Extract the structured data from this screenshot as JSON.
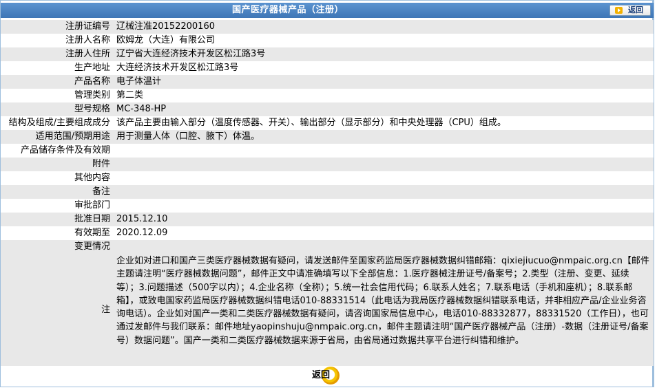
{
  "header": {
    "title": "国产医疗器械产品（注册）",
    "back_label": "返回"
  },
  "fields": [
    {
      "label": "注册证编号",
      "value": "辽械注准20152200160"
    },
    {
      "label": "注册人名称",
      "value": "欧姆龙（大连）有限公司"
    },
    {
      "label": "注册人住所",
      "value": "辽宁省大连经济技术开发区松江路3号"
    },
    {
      "label": "生产地址",
      "value": "大连经济技术开发区松江路3号"
    },
    {
      "label": "产品名称",
      "value": "电子体温计"
    },
    {
      "label": "管理类别",
      "value": "第二类"
    },
    {
      "label": "型号规格",
      "value": "MC-348-HP"
    },
    {
      "label": "结构及组成/主要组成成分",
      "value": "该产品主要由输入部分（温度传感器、开关）、输出部分（显示部分）和中央处理器（CPU）组成。"
    },
    {
      "label": "适用范围/预期用途",
      "value": "用于测量人体（口腔、腋下）体温。"
    },
    {
      "label": "产品储存条件及有效期",
      "value": ""
    },
    {
      "label": "附件",
      "value": ""
    },
    {
      "label": "其他内容",
      "value": ""
    },
    {
      "label": "备注",
      "value": ""
    },
    {
      "label": "审批部门",
      "value": ""
    },
    {
      "label": "批准日期",
      "value": "2015.12.10"
    },
    {
      "label": "有效期至",
      "value": "2020.12.09"
    },
    {
      "label": "变更情况",
      "value": ""
    }
  ],
  "notice": {
    "label": "注",
    "text": "企业如对进口和国产三类医疗器械数据有疑问，请发送邮件至国家药监局医疗器械数据纠错邮箱：qixiejiucuo@nmpaic.org.cn【邮件主题请注明“医疗器械数据问题”，邮件正文中请准确填写以下全部信息：1.医疗器械注册证号/备案号；2.类型（注册、变更、延续等）；3.问题描述（500字以内）；4.企业名称（全称）；5.统一社会信用代码；6.联系人姓名；7.联系电话（手机和座机）；8.联系邮箱】，或致电国家药监局医疗器械数据纠错电话010-88331514（此电话为我局医疗器械数据纠错联系电话，并非相应产品/企业业务咨询电话）。企业如对国产一类和二类医疗器械数据有疑问，请咨询国家局信息中心，电话010-88332877，88331520（工作日），也可通过发邮件与我们联系：邮件地址yaopinshuju@nmpaic.org.cn，邮件主题请注明“国产医疗器械产品（注册）-数据（注册证号/备案号）数据问题”。国产一类和二类医疗器械数据来源于省局，由省局通过数据共享平台进行纠错和维护。"
  },
  "footer": {
    "back_label": "返回"
  },
  "colors": {
    "title_bar": "#4a84c4",
    "row_gray": "#e8e8e8",
    "row_white": "#ffffff",
    "back_accent": "#f2b100"
  }
}
